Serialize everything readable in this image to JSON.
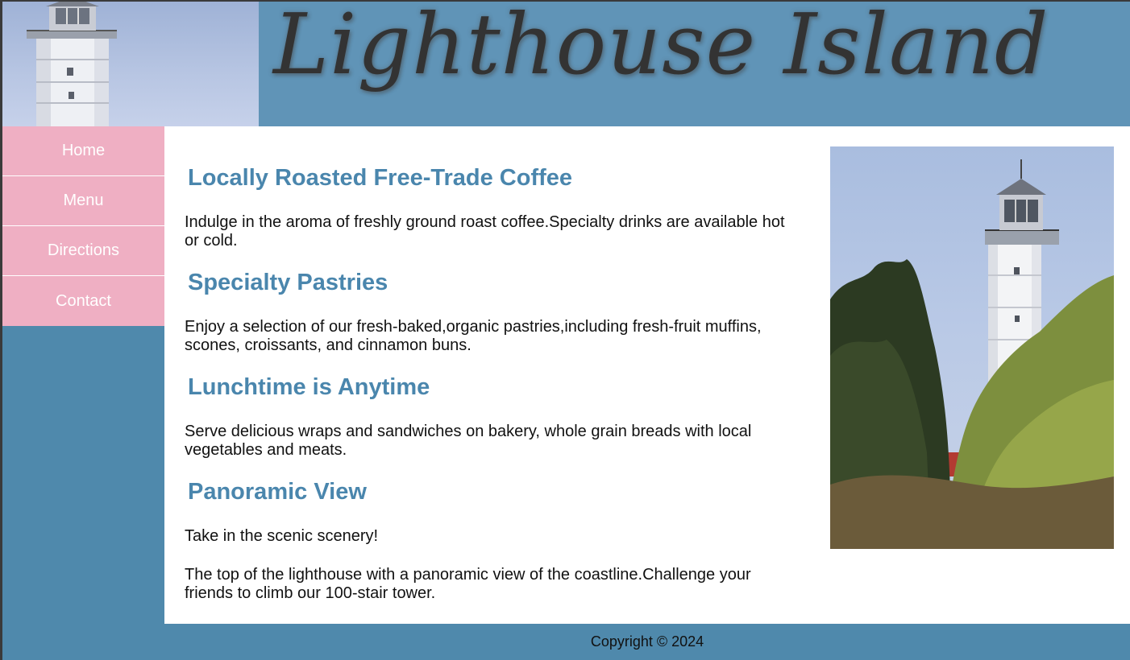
{
  "header": {
    "title": "Lighthouse Island"
  },
  "nav": {
    "items": [
      {
        "label": "Home"
      },
      {
        "label": "Menu"
      },
      {
        "label": "Directions"
      },
      {
        "label": "Contact"
      }
    ]
  },
  "sections": [
    {
      "heading": "Locally Roasted Free-Trade Coffee",
      "text": "Indulge in the aroma of freshly ground roast coffee.Specialty drinks are available hot or cold."
    },
    {
      "heading": "Specialty Pastries",
      "text": "Enjoy a selection of our fresh-baked,organic pastries,including fresh-fruit muffins, scones, croissants, and cinnamon buns."
    },
    {
      "heading": "Lunchtime is Anytime",
      "text": "Serve delicious wraps and sandwiches on bakery, whole grain breads with local vegetables and meats."
    },
    {
      "heading": "Panoramic View",
      "text": "Take in the scenic scenery!",
      "text2": "The top of the lighthouse with a panoramic view of the coastline.Challenge your friends to climb our 100-stair tower."
    }
  ],
  "footer": {
    "copyright": "Copyright © 2024"
  },
  "colors": {
    "page_background": "#4f89ac",
    "header_background": "#6094b7",
    "nav_background": "#efafc3",
    "heading_color": "#4a86ad"
  }
}
